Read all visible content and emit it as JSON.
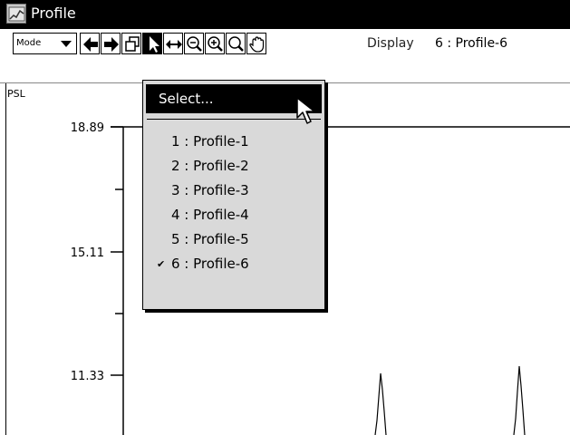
{
  "window": {
    "title": "Profile"
  },
  "toolbar": {
    "mode_label": "Mode",
    "display_label": "Display",
    "display_value": "6 :  Profile-6",
    "tools": [
      "back-arrow-icon",
      "forward-arrow-icon",
      "duplicate-windows-icon",
      "pointer-icon",
      "horizontal-zoom-icon",
      "zoom-out-icon",
      "zoom-in-icon",
      "magnifier-icon",
      "hand-icon"
    ]
  },
  "menu": {
    "select_label": "Select...",
    "items": [
      {
        "label": "1 : Profile-1",
        "checked": false
      },
      {
        "label": "2 : Profile-2",
        "checked": false
      },
      {
        "label": "3 : Profile-3",
        "checked": false
      },
      {
        "label": "4 : Profile-4",
        "checked": false
      },
      {
        "label": "5 : Profile-5",
        "checked": false
      },
      {
        "label": "6 : Profile-6",
        "checked": true
      }
    ],
    "check_mark": "✔"
  },
  "plot": {
    "y_unit": "PSL",
    "y_ticks": [
      "18.89",
      "15.11",
      "11.33"
    ],
    "line_color": "#000000"
  }
}
